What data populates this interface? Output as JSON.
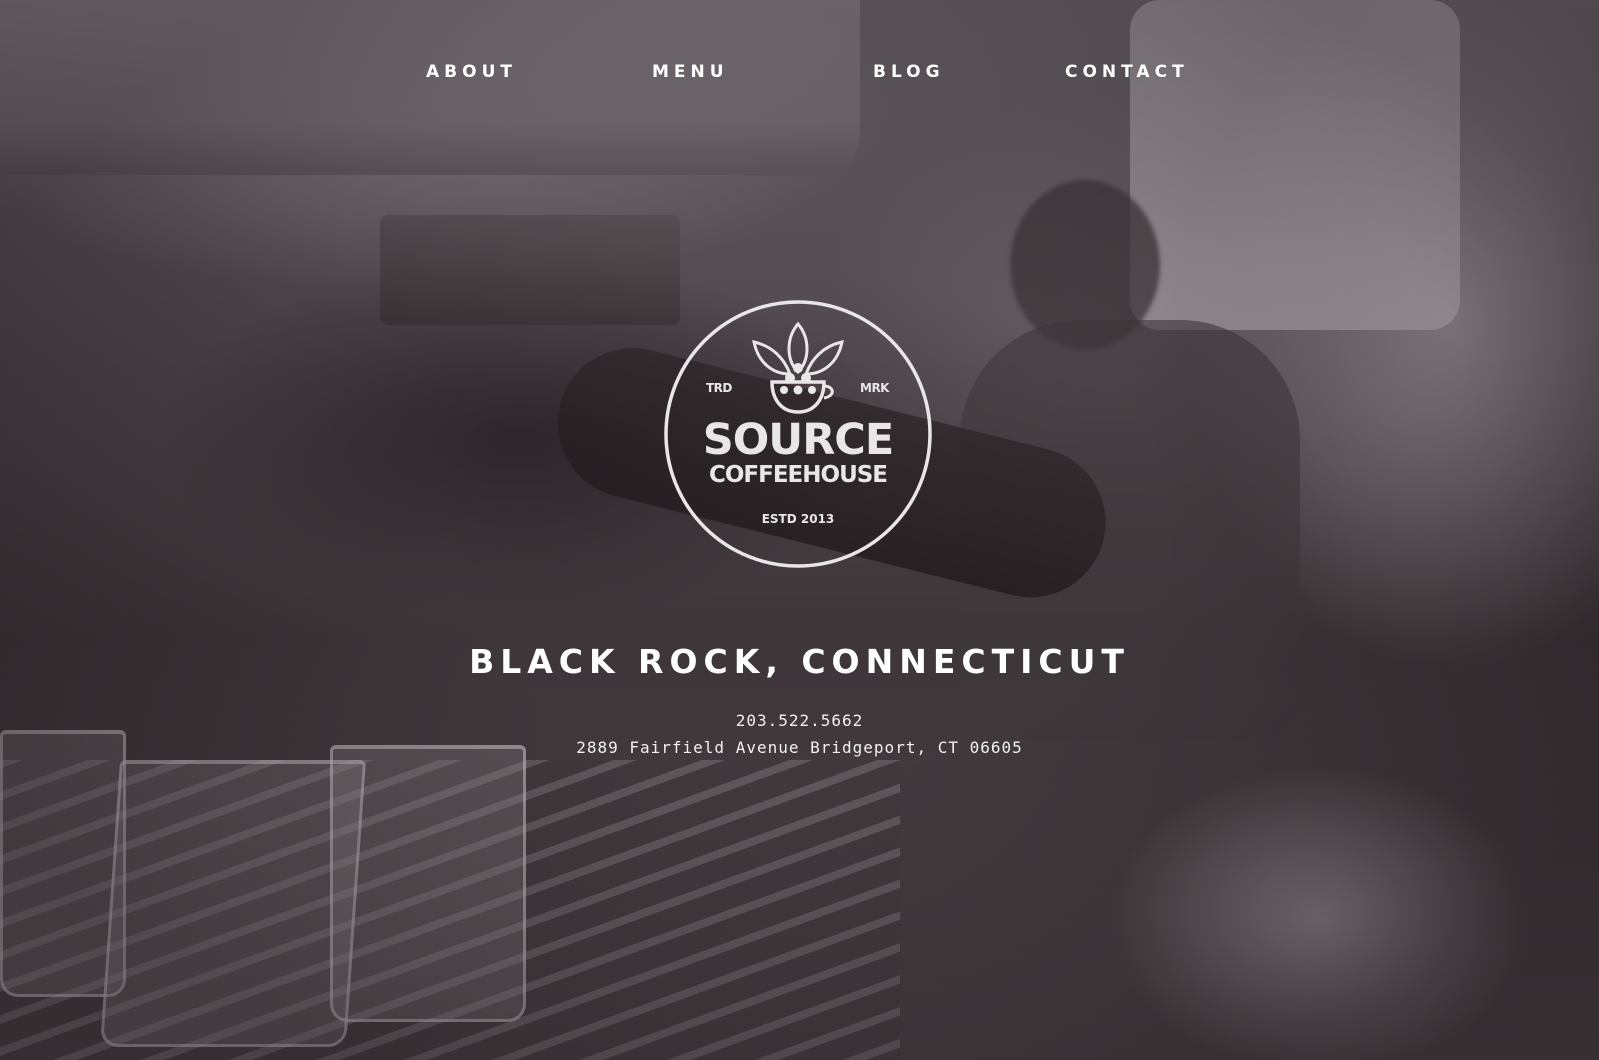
{
  "nav": {
    "items": [
      {
        "label": "ABOUT"
      },
      {
        "label": "MENU"
      },
      {
        "label": "BLOG"
      },
      {
        "label": "CONTACT"
      }
    ]
  },
  "logo": {
    "trd": "TRD",
    "mrk": "MRK",
    "name_line1": "SOURCE",
    "name_line2": "COFFEEHOUSE",
    "established": "ESTD 2013",
    "icon": "coffee-cup-leaves-icon"
  },
  "location": {
    "title": "BLACK ROCK, CONNECTICUT",
    "phone": "203.522.5662",
    "address": "2889 Fairfield Avenue Bridgeport, CT 06605"
  },
  "colors": {
    "text": "#ffffff",
    "logo": "#e9e6e8",
    "overlay": "#3d3538"
  }
}
